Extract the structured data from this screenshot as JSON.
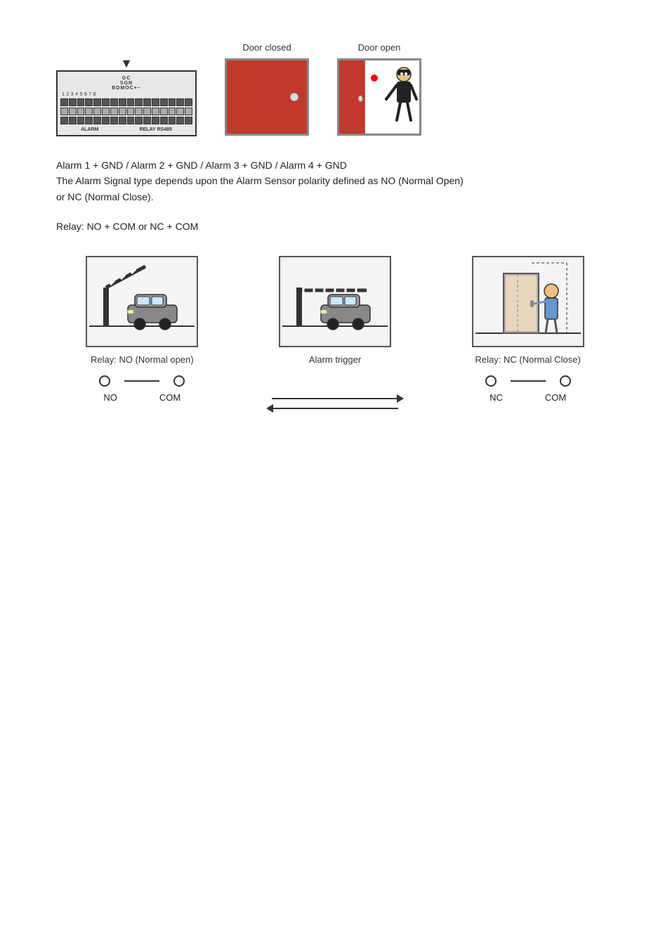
{
  "header": {
    "door_closed_label": "Door closed",
    "door_open_label": "Door open"
  },
  "alarm_text": {
    "line1": "Alarm 1 + GND / Alarm 2 + GND / Alarm 3 + GND / Alarm 4 + GND",
    "line2": "The Alarm Signal type depends upon the Alarm Sensor polarity defined as NO (Normal Open)",
    "line3": "or NC (Normal Close)."
  },
  "relay_text": "Relay: NO + COM or NC + COM",
  "diagrams": [
    {
      "id": "relay-no",
      "caption": "Relay: NO (Normal open)",
      "node1_label": "NO",
      "node2_label": "COM"
    },
    {
      "id": "alarm-trigger",
      "caption": "Alarm trigger"
    },
    {
      "id": "relay-nc",
      "caption": "Relay: NC (Normal Close)",
      "node1_label": "NC",
      "node2_label": "COM"
    }
  ],
  "board": {
    "labels_top": "GC\nSGN\nBDMOC+-",
    "numbers": "12345678"
  }
}
